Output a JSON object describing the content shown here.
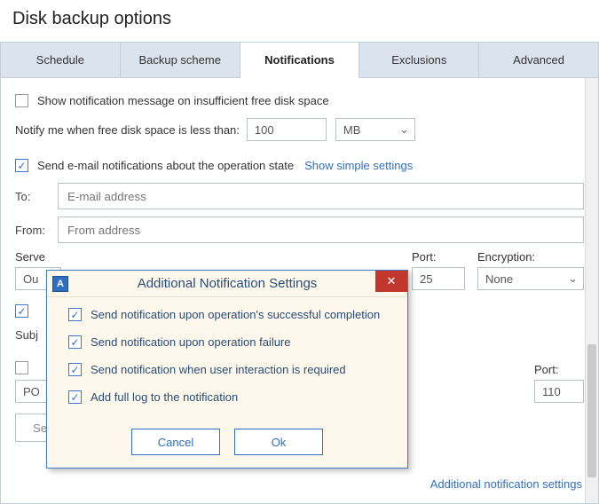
{
  "title": "Disk backup options",
  "tabs": {
    "schedule": "Schedule",
    "scheme": "Backup scheme",
    "notifications": "Notifications",
    "exclusions": "Exclusions",
    "advanced": "Advanced"
  },
  "opt": {
    "insufficient_space": "Show notification message on insufficient free disk space",
    "threshold_label": "Notify me when free disk space is less than:",
    "threshold_value": "100",
    "threshold_unit": "MB",
    "email_state": "Send e-mail notifications about the operation state",
    "simple_settings": "Show simple settings",
    "to_label": "To:",
    "to_placeholder": "E-mail address",
    "from_label": "From:",
    "from_placeholder": "From address",
    "server_label": "Serve",
    "server_value": "Ou",
    "port_label": "Port:",
    "port_value": "25",
    "encryption_label": "Encryption:",
    "encryption_value": "None",
    "subject_label": "Subj",
    "po_value": "PO",
    "port2_label": "Port:",
    "port2_value": "110",
    "send_btn": "Se",
    "addl_link": "Additional notification settings"
  },
  "modal": {
    "title": "Additional Notification Settings",
    "items": {
      "success": "Send notification upon operation's successful completion",
      "failure": "Send notification upon operation failure",
      "interaction": "Send notification when user interaction is required",
      "fulllog": "Add full log to the notification"
    },
    "cancel": "Cancel",
    "ok": "Ok"
  }
}
